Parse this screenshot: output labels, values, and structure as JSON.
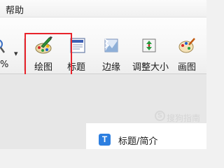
{
  "menubar": {
    "help_label": "帮助"
  },
  "toolbar": {
    "percent_label": "%",
    "dropdown_symbol": "▾",
    "buttons": [
      {
        "label": "绘图",
        "icon": "paint-palette-icon"
      },
      {
        "label": "标题",
        "icon": "title-icon"
      },
      {
        "label": "边缘",
        "icon": "edge-icon"
      },
      {
        "label": "调整大小",
        "icon": "resize-icon"
      },
      {
        "label": "画图",
        "icon": "paint-icon"
      }
    ]
  },
  "panel": {
    "icon_letter": "T",
    "label": "标题/简介"
  },
  "watermark": {
    "logo": "S",
    "text": "搜狗指南"
  },
  "colors": {
    "highlight": "#e8232b",
    "panel_icon": "#2d7fe0"
  }
}
